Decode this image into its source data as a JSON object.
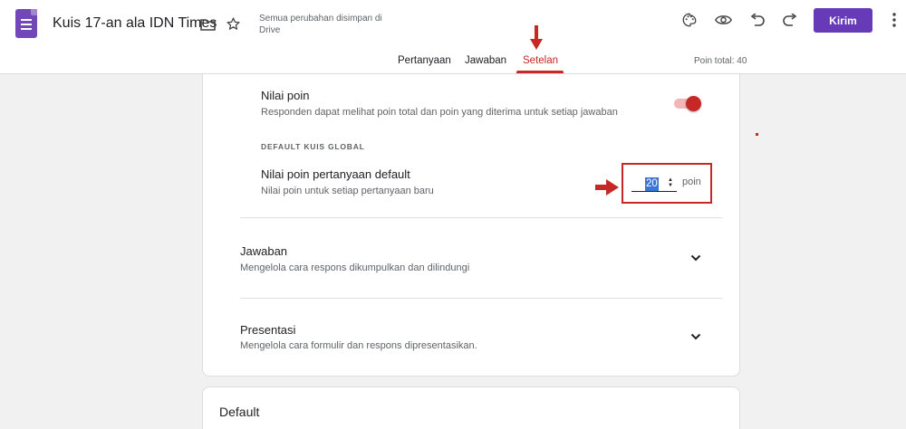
{
  "header": {
    "title": "Kuis 17-an ala IDN Times",
    "saved_status": "Semua perubahan disimpan di Drive",
    "send_label": "Kirim",
    "icons": [
      "forms-logo-icon",
      "folder-icon",
      "star-icon",
      "palette-icon",
      "preview-eye-icon",
      "undo-icon",
      "redo-icon",
      "more-vert-icon"
    ]
  },
  "tabs": {
    "items": [
      {
        "label": "Pertanyaan",
        "active": false
      },
      {
        "label": "Jawaban",
        "active": false
      },
      {
        "label": "Setelan",
        "active": true
      }
    ],
    "points_total": "Poin total: 40"
  },
  "settings": {
    "point_value": {
      "title": "Nilai poin",
      "description": "Responden dapat melihat poin total dan poin yang diterima untuk setiap jawaban",
      "enabled": true
    },
    "global_quiz_default": {
      "heading": "DEFAULT KUIS GLOBAL",
      "title": "Nilai poin pertanyaan default",
      "description": "Nilai poin untuk setiap pertanyaan baru",
      "value": "20",
      "unit": "poin"
    },
    "responses": {
      "title": "Jawaban",
      "description": "Mengelola cara respons dikumpulkan dan dilindungi"
    },
    "presentation": {
      "title": "Presentasi",
      "description": "Mengelola cara formulir dan respons dipresentasikan."
    }
  },
  "defaults_card": {
    "title": "Default"
  },
  "colors": {
    "accent_purple": "#673ab7",
    "annotation_red": "#c62828",
    "background": "#f1f1f1"
  }
}
